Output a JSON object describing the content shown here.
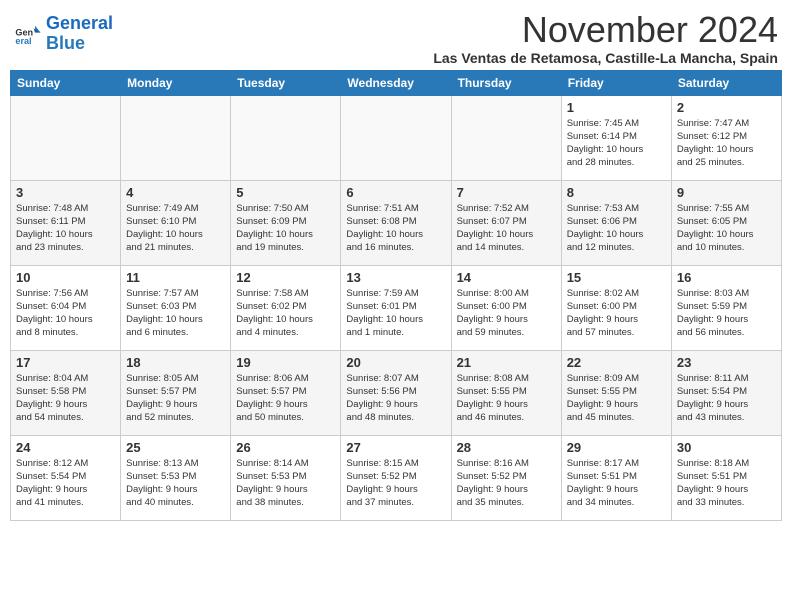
{
  "header": {
    "logo_line1": "General",
    "logo_line2": "Blue",
    "month": "November 2024",
    "location": "Las Ventas de Retamosa, Castille-La Mancha, Spain"
  },
  "weekdays": [
    "Sunday",
    "Monday",
    "Tuesday",
    "Wednesday",
    "Thursday",
    "Friday",
    "Saturday"
  ],
  "weeks": [
    [
      {
        "day": "",
        "info": ""
      },
      {
        "day": "",
        "info": ""
      },
      {
        "day": "",
        "info": ""
      },
      {
        "day": "",
        "info": ""
      },
      {
        "day": "",
        "info": ""
      },
      {
        "day": "1",
        "info": "Sunrise: 7:45 AM\nSunset: 6:14 PM\nDaylight: 10 hours\nand 28 minutes."
      },
      {
        "day": "2",
        "info": "Sunrise: 7:47 AM\nSunset: 6:12 PM\nDaylight: 10 hours\nand 25 minutes."
      }
    ],
    [
      {
        "day": "3",
        "info": "Sunrise: 7:48 AM\nSunset: 6:11 PM\nDaylight: 10 hours\nand 23 minutes."
      },
      {
        "day": "4",
        "info": "Sunrise: 7:49 AM\nSunset: 6:10 PM\nDaylight: 10 hours\nand 21 minutes."
      },
      {
        "day": "5",
        "info": "Sunrise: 7:50 AM\nSunset: 6:09 PM\nDaylight: 10 hours\nand 19 minutes."
      },
      {
        "day": "6",
        "info": "Sunrise: 7:51 AM\nSunset: 6:08 PM\nDaylight: 10 hours\nand 16 minutes."
      },
      {
        "day": "7",
        "info": "Sunrise: 7:52 AM\nSunset: 6:07 PM\nDaylight: 10 hours\nand 14 minutes."
      },
      {
        "day": "8",
        "info": "Sunrise: 7:53 AM\nSunset: 6:06 PM\nDaylight: 10 hours\nand 12 minutes."
      },
      {
        "day": "9",
        "info": "Sunrise: 7:55 AM\nSunset: 6:05 PM\nDaylight: 10 hours\nand 10 minutes."
      }
    ],
    [
      {
        "day": "10",
        "info": "Sunrise: 7:56 AM\nSunset: 6:04 PM\nDaylight: 10 hours\nand 8 minutes."
      },
      {
        "day": "11",
        "info": "Sunrise: 7:57 AM\nSunset: 6:03 PM\nDaylight: 10 hours\nand 6 minutes."
      },
      {
        "day": "12",
        "info": "Sunrise: 7:58 AM\nSunset: 6:02 PM\nDaylight: 10 hours\nand 4 minutes."
      },
      {
        "day": "13",
        "info": "Sunrise: 7:59 AM\nSunset: 6:01 PM\nDaylight: 10 hours\nand 1 minute."
      },
      {
        "day": "14",
        "info": "Sunrise: 8:00 AM\nSunset: 6:00 PM\nDaylight: 9 hours\nand 59 minutes."
      },
      {
        "day": "15",
        "info": "Sunrise: 8:02 AM\nSunset: 6:00 PM\nDaylight: 9 hours\nand 57 minutes."
      },
      {
        "day": "16",
        "info": "Sunrise: 8:03 AM\nSunset: 5:59 PM\nDaylight: 9 hours\nand 56 minutes."
      }
    ],
    [
      {
        "day": "17",
        "info": "Sunrise: 8:04 AM\nSunset: 5:58 PM\nDaylight: 9 hours\nand 54 minutes."
      },
      {
        "day": "18",
        "info": "Sunrise: 8:05 AM\nSunset: 5:57 PM\nDaylight: 9 hours\nand 52 minutes."
      },
      {
        "day": "19",
        "info": "Sunrise: 8:06 AM\nSunset: 5:57 PM\nDaylight: 9 hours\nand 50 minutes."
      },
      {
        "day": "20",
        "info": "Sunrise: 8:07 AM\nSunset: 5:56 PM\nDaylight: 9 hours\nand 48 minutes."
      },
      {
        "day": "21",
        "info": "Sunrise: 8:08 AM\nSunset: 5:55 PM\nDaylight: 9 hours\nand 46 minutes."
      },
      {
        "day": "22",
        "info": "Sunrise: 8:09 AM\nSunset: 5:55 PM\nDaylight: 9 hours\nand 45 minutes."
      },
      {
        "day": "23",
        "info": "Sunrise: 8:11 AM\nSunset: 5:54 PM\nDaylight: 9 hours\nand 43 minutes."
      }
    ],
    [
      {
        "day": "24",
        "info": "Sunrise: 8:12 AM\nSunset: 5:54 PM\nDaylight: 9 hours\nand 41 minutes."
      },
      {
        "day": "25",
        "info": "Sunrise: 8:13 AM\nSunset: 5:53 PM\nDaylight: 9 hours\nand 40 minutes."
      },
      {
        "day": "26",
        "info": "Sunrise: 8:14 AM\nSunset: 5:53 PM\nDaylight: 9 hours\nand 38 minutes."
      },
      {
        "day": "27",
        "info": "Sunrise: 8:15 AM\nSunset: 5:52 PM\nDaylight: 9 hours\nand 37 minutes."
      },
      {
        "day": "28",
        "info": "Sunrise: 8:16 AM\nSunset: 5:52 PM\nDaylight: 9 hours\nand 35 minutes."
      },
      {
        "day": "29",
        "info": "Sunrise: 8:17 AM\nSunset: 5:51 PM\nDaylight: 9 hours\nand 34 minutes."
      },
      {
        "day": "30",
        "info": "Sunrise: 8:18 AM\nSunset: 5:51 PM\nDaylight: 9 hours\nand 33 minutes."
      }
    ]
  ]
}
